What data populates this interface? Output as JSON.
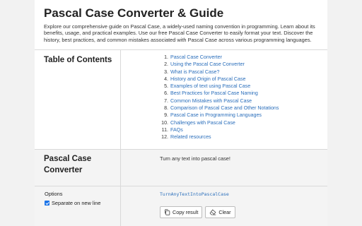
{
  "header": {
    "title": "Pascal Case Converter & Guide",
    "intro": "Explore our comprehensive guide on Pascal Case, a widely-used naming convention in programming. Learn about its benefits, usage, and practical examples. Use our free Pascal Case Converter to easily format your text. Discover the history, best practices, and common mistakes associated with Pascal Case across various programming languages."
  },
  "toc": {
    "title": "Table of Contents",
    "items": [
      {
        "num": "1.",
        "label": "Pascal Case Converter"
      },
      {
        "num": "2.",
        "label": "Using the Pascal Case Converter"
      },
      {
        "num": "3.",
        "label": "What is Pascal Case?"
      },
      {
        "num": "4.",
        "label": "History and Origin of Pascal Case"
      },
      {
        "num": "5.",
        "label": "Examples of text using Pascal Case"
      },
      {
        "num": "6.",
        "label": "Best Practices for Pascal Case Naming"
      },
      {
        "num": "7.",
        "label": "Common Mistakes with Pascal Case"
      },
      {
        "num": "8.",
        "label": "Comparison of Pascal Case and Other Notations"
      },
      {
        "num": "9.",
        "label": "Pascal Case in Programming Languages"
      },
      {
        "num": "10.",
        "label": "Challenges with Pascal Case"
      },
      {
        "num": "11.",
        "label": "FAQs"
      },
      {
        "num": "12.",
        "label": "Related resources"
      }
    ]
  },
  "converter": {
    "title": "Pascal Case Converter",
    "input_text": "Turn any text into pascal case!"
  },
  "options": {
    "label": "Options",
    "separate_label": "Separate on new line",
    "separate_checked": true,
    "output": "TurnAnyTextIntoPascalCase",
    "copy_label": "Copy result",
    "clear_label": "Clear"
  },
  "colors": {
    "link": "#2a6ebb",
    "checkbox": "#1a73e8"
  },
  "icons": {
    "copy": "copy-icon",
    "clear": "eraser-icon",
    "check": "check-icon"
  }
}
